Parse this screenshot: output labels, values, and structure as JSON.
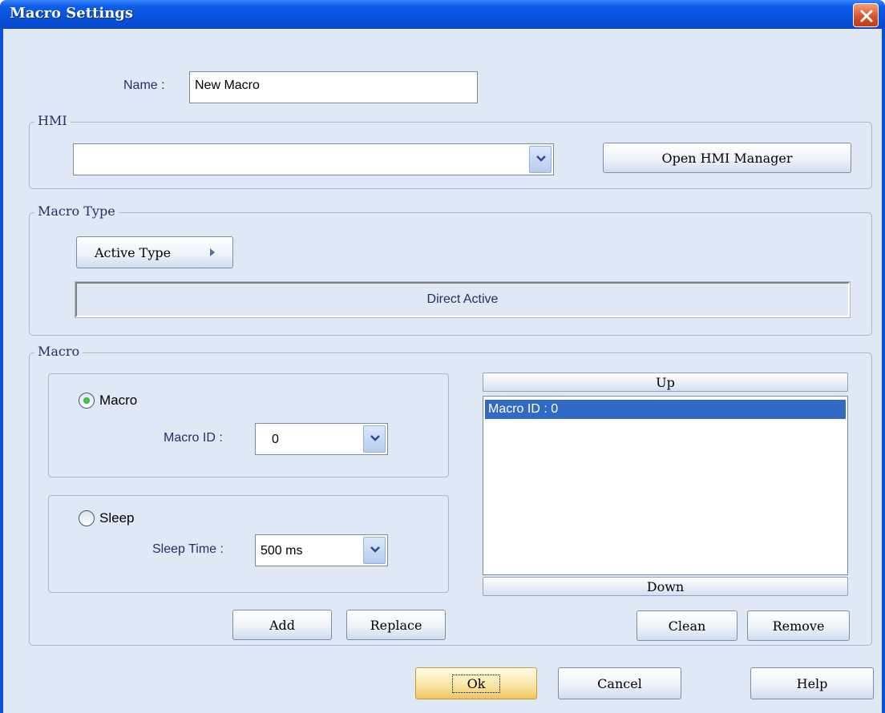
{
  "window": {
    "title": "Macro Settings"
  },
  "name_field": {
    "label": "Name :",
    "value": "New Macro"
  },
  "hmi": {
    "group_title": "HMI",
    "selected": "",
    "open_manager_label": "Open HMI Manager"
  },
  "macro_type": {
    "group_title": "Macro Type",
    "active_type_label": "Active Type",
    "status": "Direct Active"
  },
  "macro": {
    "group_title": "Macro",
    "macro_option": {
      "label": "Macro",
      "selected": true
    },
    "macro_id": {
      "label": "Macro ID :",
      "value": "0"
    },
    "sleep_option": {
      "label": "Sleep",
      "selected": false
    },
    "sleep_time": {
      "label": "Sleep Time :",
      "value": "500 ms"
    },
    "add_label": "Add",
    "replace_label": "Replace",
    "list": {
      "up_label": "Up",
      "down_label": "Down",
      "items": [
        "Macro ID : 0"
      ]
    },
    "clean_label": "Clean",
    "remove_label": "Remove"
  },
  "footer": {
    "ok_label": "Ok",
    "cancel_label": "Cancel",
    "help_label": "Help"
  },
  "colors": {
    "titlebar": "#0a50d8",
    "dialog_bg": "#dfe8f5",
    "selection": "#316ac5",
    "label_text": "#20306a"
  }
}
